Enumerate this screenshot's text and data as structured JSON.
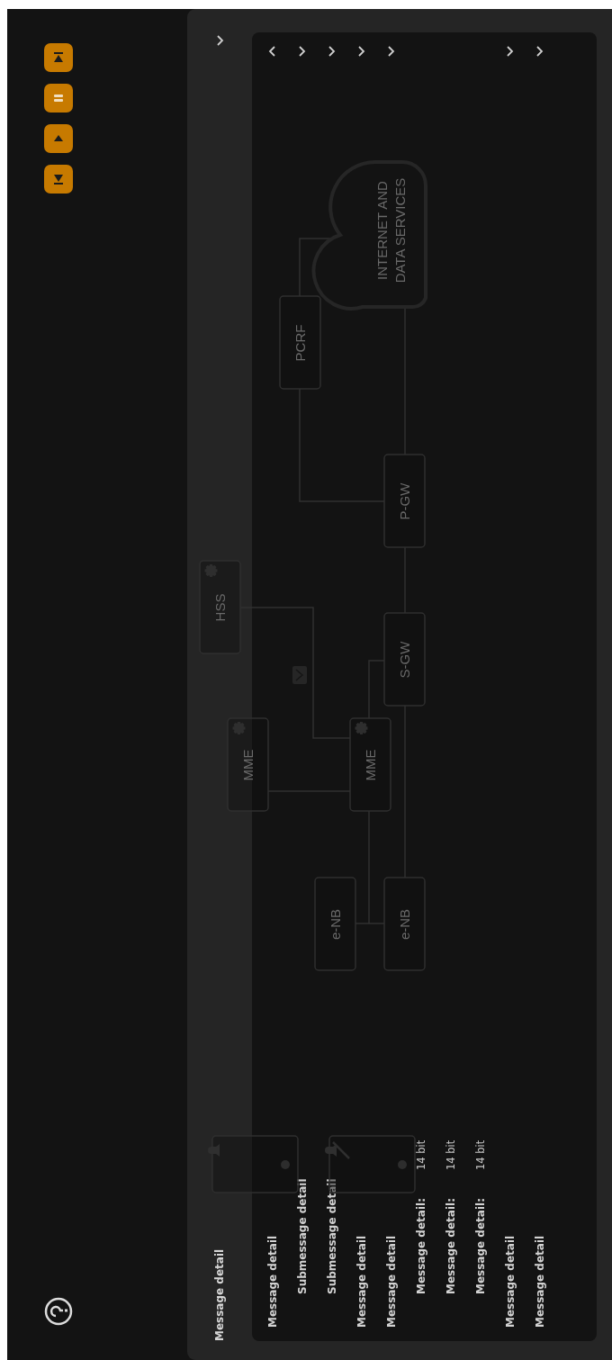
{
  "panel": {
    "title": "Message detail",
    "expanded": false
  },
  "rows": [
    {
      "kind": "group",
      "label": "Message detail",
      "expanded": true
    },
    {
      "kind": "subgroup",
      "label": "Submessage detail",
      "expanded": false
    },
    {
      "kind": "subgroup",
      "label": "Submessage detail",
      "expanded": false
    },
    {
      "kind": "group",
      "label": "Message detail",
      "expanded": false
    },
    {
      "kind": "group",
      "label": "Message detail",
      "expanded": false
    },
    {
      "kind": "field",
      "label": "Message detail:",
      "value": "14 bit"
    },
    {
      "kind": "field",
      "label": "Message detail:",
      "value": "14 bit"
    },
    {
      "kind": "field",
      "label": "Message detail:",
      "value": "14 bit"
    },
    {
      "kind": "group",
      "label": "Message detail",
      "expanded": false
    },
    {
      "kind": "group",
      "label": "Message detail",
      "expanded": false
    }
  ],
  "diagram": {
    "nodes": [
      {
        "label": "e-NB",
        "gear": false
      },
      {
        "label": "e-NB",
        "gear": false
      },
      {
        "label": "MME",
        "gear": true
      },
      {
        "label": "MME",
        "gear": true
      },
      {
        "label": "HSS",
        "gear": true
      },
      {
        "label": "S-GW",
        "gear": false
      },
      {
        "label": "P-GW",
        "gear": false
      },
      {
        "label": "PCRF",
        "gear": false
      }
    ],
    "cloud": {
      "lines": [
        "INTERNET AND",
        "DATA SERVICES"
      ]
    },
    "devices": [
      {
        "muted": false
      },
      {
        "muted": true
      }
    ]
  }
}
